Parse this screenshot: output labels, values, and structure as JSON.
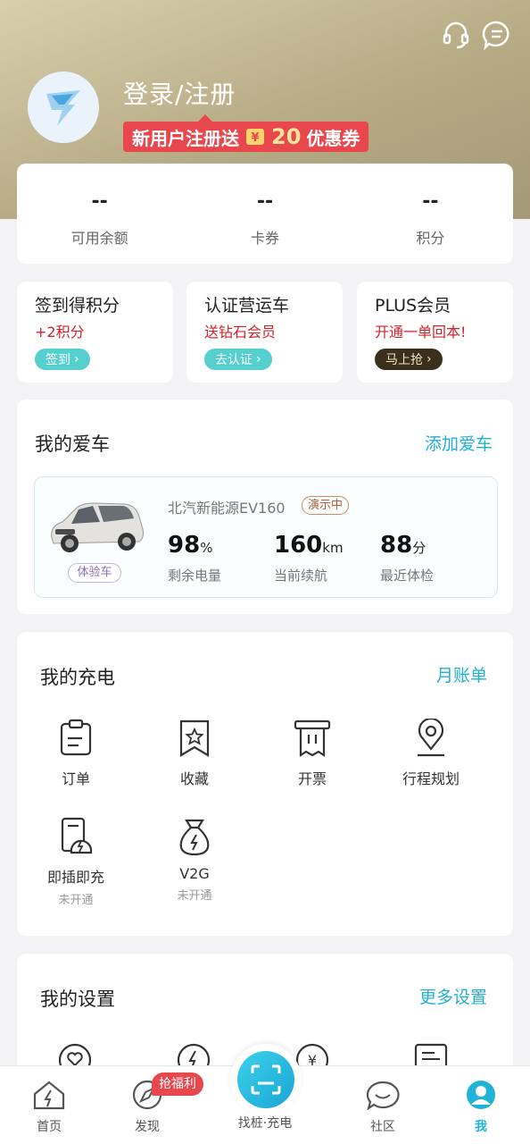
{
  "header": {
    "login_title": "登录/注册",
    "promo_prefix": "新用户注册送",
    "promo_amount": "20",
    "promo_suffix": "优惠券"
  },
  "stats": [
    {
      "value": "--",
      "label": "可用余额"
    },
    {
      "value": "--",
      "label": "卡券"
    },
    {
      "value": "--",
      "label": "积分"
    }
  ],
  "promos": [
    {
      "title": "签到得积分",
      "subtitle": "+2积分",
      "button": "签到"
    },
    {
      "title": "认证营运车",
      "subtitle": "送钻石会员",
      "button": "去认证"
    },
    {
      "title": "PLUS会员",
      "subtitle": "开通一单回本!",
      "button": "马上抢"
    }
  ],
  "my_car": {
    "title": "我的爱车",
    "add_link": "添加爱车",
    "car_name": "北汽新能源EV160",
    "status": "演示中",
    "badge": "体验车",
    "metrics": [
      {
        "value": "98",
        "unit": "%",
        "label": "剩余电量"
      },
      {
        "value": "160",
        "unit": "km",
        "label": "当前续航"
      },
      {
        "value": "88",
        "unit": "分",
        "label": "最近体检"
      }
    ]
  },
  "charging": {
    "title": "我的充电",
    "link": "月账单",
    "items": [
      {
        "label": "订单",
        "icon": "clipboard-icon"
      },
      {
        "label": "收藏",
        "icon": "bookmark-star-icon"
      },
      {
        "label": "开票",
        "icon": "receipt-icon"
      },
      {
        "label": "行程规划",
        "icon": "location-pin-icon"
      },
      {
        "label": "即插即充",
        "sub": "未开通",
        "icon": "plug-charge-icon"
      },
      {
        "label": "V2G",
        "sub": "未开通",
        "icon": "energy-bag-icon"
      }
    ]
  },
  "settings": {
    "title": "我的设置",
    "link": "更多设置"
  },
  "tabbar": {
    "home": "首页",
    "discover": "发现",
    "discover_tag": "抢福利",
    "center": "找桩·充电",
    "community": "社区",
    "me": "我"
  },
  "colors": {
    "accent": "#1fb3d8",
    "promo_red": "#e8474e",
    "header_gold": "#b7ab85"
  }
}
